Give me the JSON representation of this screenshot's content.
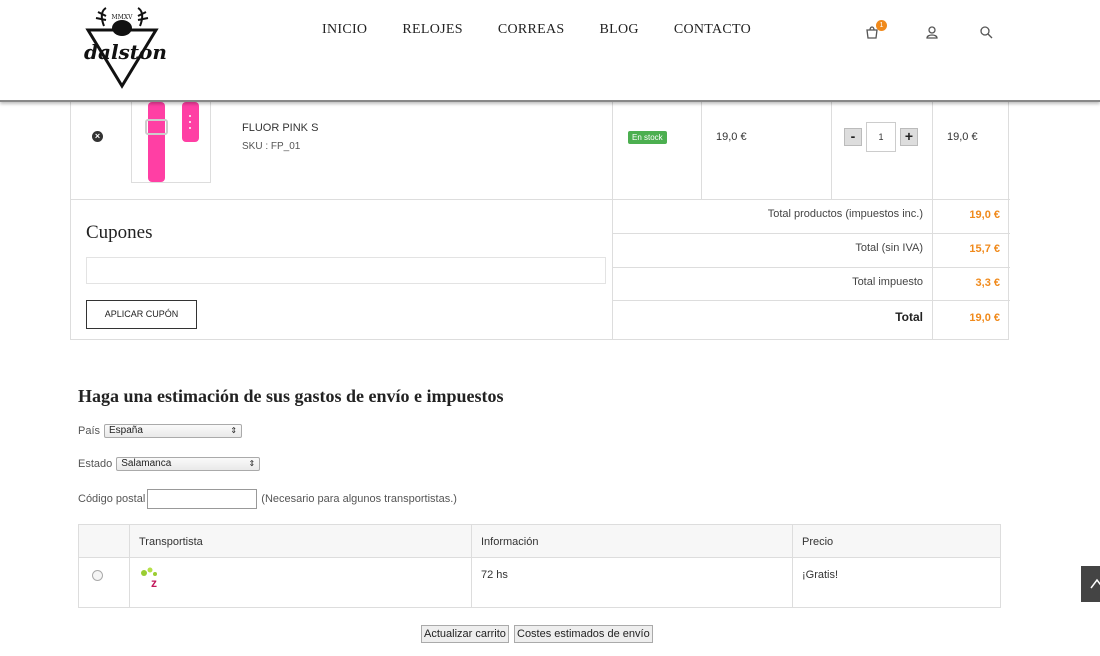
{
  "header": {
    "logo_text": "dalston",
    "logo_small": "MMXV",
    "nav": [
      "INICIO",
      "RELOJES",
      "CORREAS",
      "BLOG",
      "CONTACTO"
    ],
    "cart_count": "1"
  },
  "cart": {
    "product_name": "FLUOR PINK S",
    "sku": "SKU : FP_01",
    "stock": "En stock",
    "unit_price": "19,0 €",
    "quantity": "1",
    "qty_minus": "-",
    "qty_plus": "+",
    "line_total": "19,0 €"
  },
  "coupons": {
    "title": "Cupones",
    "apply_label": "APLICAR CUPÓN"
  },
  "totals": [
    {
      "label": "Total productos (impuestos inc.)",
      "value": "19,0 €"
    },
    {
      "label": "Total (sin IVA)",
      "value": "15,7 €"
    },
    {
      "label": "Total impuesto",
      "value": "3,3 €"
    },
    {
      "label": "Total",
      "value": "19,0 €"
    }
  ],
  "estimate": {
    "title": "Haga una estimación de sus gastos de envío e impuestos",
    "country_label": "País",
    "country_value": "España",
    "state_label": "Estado",
    "state_value": "Salamanca",
    "zip_label": "Código postal",
    "zip_note": "(Necesario para algunos transportistas.)"
  },
  "shipping": {
    "headers": [
      "Transportista",
      "Información",
      "Precio"
    ],
    "row": {
      "info": "72 hs",
      "price": "¡Gratis!"
    }
  },
  "actions": {
    "update_cart": "Actualizar carrito",
    "estimate_costs": "Costes estimados de envío"
  },
  "colors": {
    "accent": "#f08a1c",
    "stock_green": "#4caf50",
    "product_pink": "#ff3fa4"
  }
}
